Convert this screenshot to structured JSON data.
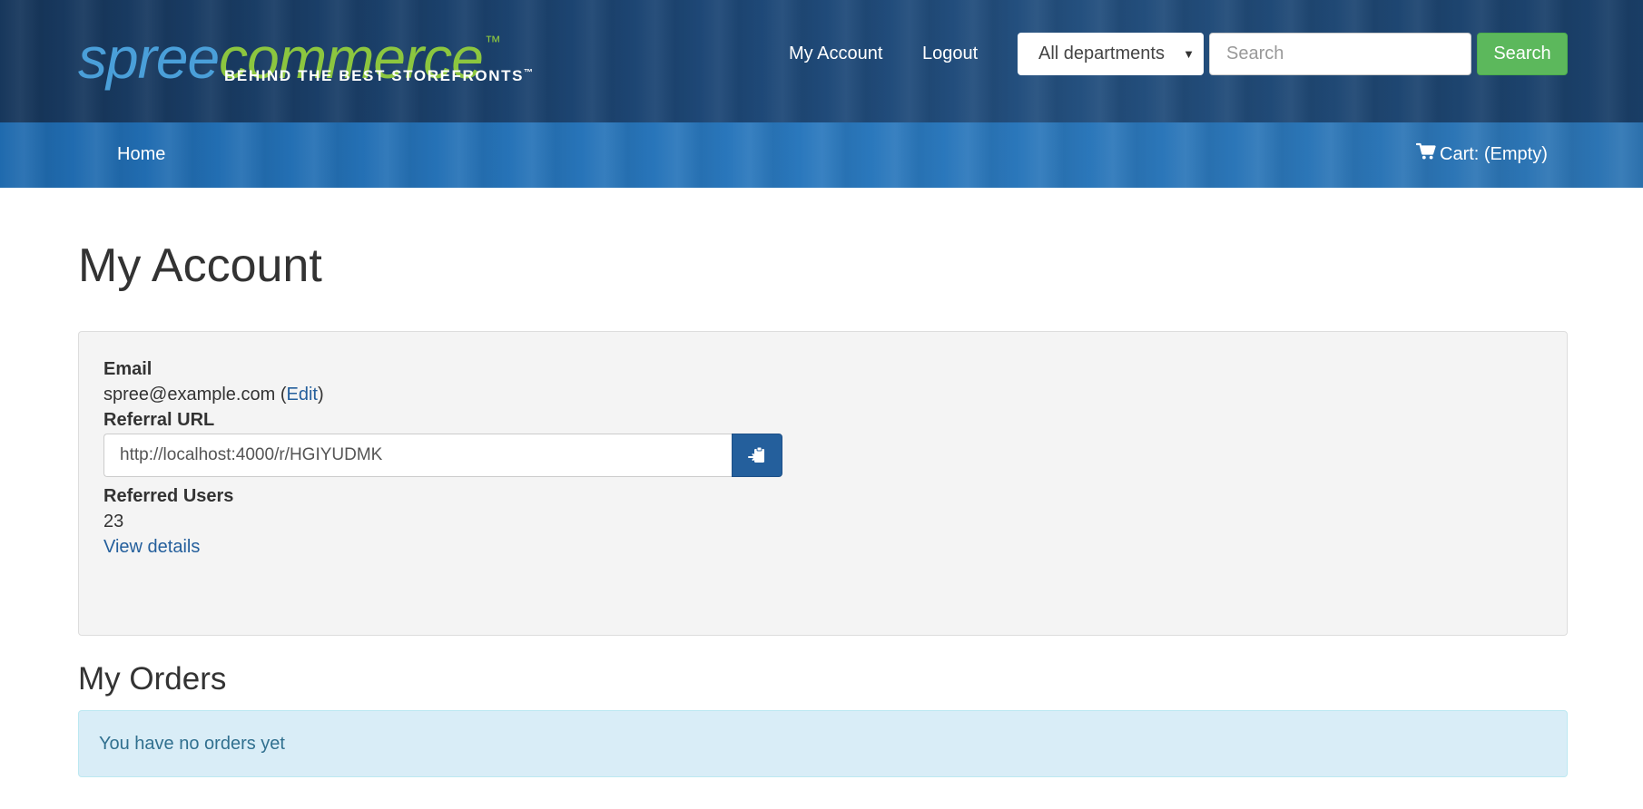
{
  "brand": {
    "logo_spree": "spree",
    "logo_commerce": "commerce",
    "logo_tm": "™",
    "tagline": "BEHIND THE BEST STOREFRONTS",
    "tagline_tm": "™",
    "colors": {
      "spree": "#4a9fd9",
      "commerce": "#8cc63f"
    }
  },
  "header": {
    "my_account": "My Account",
    "logout": "Logout",
    "department_selected": "All departments",
    "search_placeholder": "Search",
    "search_button": "Search"
  },
  "nav": {
    "home": "Home",
    "cart_label": "Cart: (Empty)",
    "cart_icon": "shopping-cart-icon"
  },
  "account": {
    "page_title": "My Account",
    "email_label": "Email",
    "email_value": "spree@example.com",
    "edit_link": "Edit",
    "referral_label": "Referral URL",
    "referral_url": "http://localhost:4000/r/HGIYUDMK",
    "copy_icon": "clipboard-paste-icon",
    "referred_users_label": "Referred Users",
    "referred_users_count": "23",
    "view_details": "View details"
  },
  "orders": {
    "title": "My Orders",
    "empty_message": "You have no orders yet"
  },
  "colors": {
    "search_button": "#5cb85c",
    "primary": "#245f9c",
    "alert_background": "#d9edf7",
    "alert_text": "#31708f",
    "panel_background": "#f4f4f4"
  }
}
